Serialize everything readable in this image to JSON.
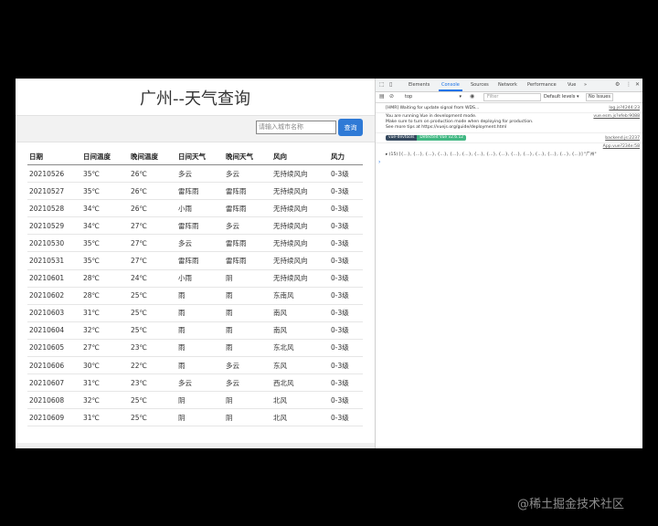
{
  "app": {
    "title": "广州--天气查询",
    "search": {
      "placeholder": "请输入城市名称",
      "button_label": "查询"
    }
  },
  "table": {
    "columns": [
      "日期",
      "日间温度",
      "晚间温度",
      "日间天气",
      "晚间天气",
      "风向",
      "风力"
    ],
    "rows": [
      [
        "20210526",
        "35℃",
        "26℃",
        "多云",
        "多云",
        "无持续风向",
        "0-3级"
      ],
      [
        "20210527",
        "35℃",
        "26℃",
        "雷阵雨",
        "雷阵雨",
        "无持续风向",
        "0-3级"
      ],
      [
        "20210528",
        "34℃",
        "26℃",
        "小雨",
        "雷阵雨",
        "无持续风向",
        "0-3级"
      ],
      [
        "20210529",
        "34℃",
        "27℃",
        "雷阵雨",
        "多云",
        "无持续风向",
        "0-3级"
      ],
      [
        "20210530",
        "35℃",
        "27℃",
        "多云",
        "雷阵雨",
        "无持续风向",
        "0-3级"
      ],
      [
        "20210531",
        "35℃",
        "27℃",
        "雷阵雨",
        "雷阵雨",
        "无持续风向",
        "0-3级"
      ],
      [
        "20210601",
        "28℃",
        "24℃",
        "小雨",
        "阴",
        "无持续风向",
        "0-3级"
      ],
      [
        "20210602",
        "28℃",
        "25℃",
        "雨",
        "雨",
        "东南风",
        "0-3级"
      ],
      [
        "20210603",
        "31℃",
        "25℃",
        "雨",
        "雨",
        "南风",
        "0-3级"
      ],
      [
        "20210604",
        "32℃",
        "25℃",
        "雨",
        "雨",
        "南风",
        "0-3级"
      ],
      [
        "20210605",
        "27℃",
        "23℃",
        "雨",
        "雨",
        "东北风",
        "0-3级"
      ],
      [
        "20210606",
        "30℃",
        "22℃",
        "雨",
        "多云",
        "东风",
        "0-3级"
      ],
      [
        "20210607",
        "31℃",
        "23℃",
        "多云",
        "多云",
        "西北风",
        "0-3级"
      ],
      [
        "20210608",
        "32℃",
        "25℃",
        "阴",
        "阴",
        "北风",
        "0-3级"
      ],
      [
        "20210609",
        "31℃",
        "25℃",
        "阴",
        "阴",
        "北风",
        "0-3级"
      ]
    ]
  },
  "devtools": {
    "tabs": [
      "Elements",
      "Console",
      "Sources",
      "Network",
      "Performance",
      "Vue"
    ],
    "active_tab": "Console",
    "more_tabs": "»",
    "context": "top",
    "filter_placeholder": "Filter",
    "levels": "Default levels ▾",
    "issues": "No Issues",
    "messages": [
      {
        "text": "[HMR] Waiting for update signal from WDS...",
        "source": "log.js?4244:23"
      },
      {
        "text": "You are running Vue in development mode.",
        "source": "vue.esm.js?efeb:9088"
      },
      {
        "text": "Make sure to turn on production mode when deploying for production."
      },
      {
        "text": "See more tips at https://vuejs.org/guide/deployment.html"
      }
    ],
    "badge_left": "vue-devtools",
    "badge_right": "Detected Vue v2.6.12",
    "badge_source": "backend.js:2237",
    "array_source": "App.vue?234e:58",
    "array_log": "▸ (15) [{…}, {…}, {…}, {…}, {…}, {…}, {…}, {…}, {…}, {…}, {…}, {…}, {…}, {…}, {…}] \"广州\"",
    "prompt": "›"
  },
  "watermark": "@稀土掘金技术社区",
  "colors": {
    "accent": "#2f7ad6",
    "vue_green": "#41b883",
    "devtools_blue": "#1a73e8"
  }
}
